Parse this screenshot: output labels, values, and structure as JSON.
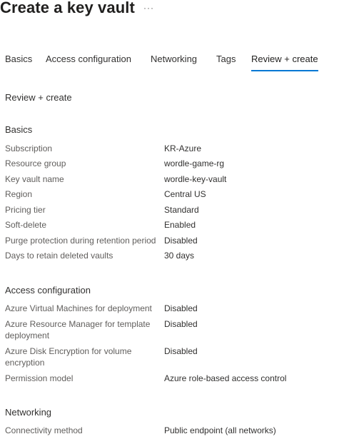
{
  "header": {
    "title": "Create a key vault",
    "more_label": "···"
  },
  "tabs": [
    {
      "label": "Basics",
      "active": false
    },
    {
      "label": "Access configuration",
      "active": false
    },
    {
      "label": "Networking",
      "active": false
    },
    {
      "label": "Tags",
      "active": false
    },
    {
      "label": "Review + create",
      "active": true
    }
  ],
  "review": {
    "subtitle": "Review + create"
  },
  "sections": {
    "basics": {
      "heading": "Basics",
      "rows": [
        {
          "label": "Subscription",
          "value": "KR-Azure"
        },
        {
          "label": "Resource group",
          "value": "wordle-game-rg"
        },
        {
          "label": "Key vault name",
          "value": "wordle-key-vault"
        },
        {
          "label": "Region",
          "value": "Central US"
        },
        {
          "label": "Pricing tier",
          "value": "Standard"
        },
        {
          "label": "Soft-delete",
          "value": "Enabled"
        },
        {
          "label": "Purge protection during retention period",
          "value": "Disabled"
        },
        {
          "label": "Days to retain deleted vaults",
          "value": "30 days"
        }
      ]
    },
    "access": {
      "heading": "Access configuration",
      "rows": [
        {
          "label": "Azure Virtual Machines for deployment",
          "value": "Disabled"
        },
        {
          "label": "Azure Resource Manager for template deployment",
          "value": "Disabled"
        },
        {
          "label": "Azure Disk Encryption for volume encryption",
          "value": "Disabled"
        },
        {
          "label": "Permission model",
          "value": "Azure role-based access control"
        }
      ]
    },
    "networking": {
      "heading": "Networking",
      "rows": [
        {
          "label": "Connectivity method",
          "value": "Public endpoint (all networks)"
        }
      ]
    }
  },
  "colors": {
    "accent": "#0078d4",
    "label_text": "#605e5c",
    "value_text": "#323130"
  }
}
